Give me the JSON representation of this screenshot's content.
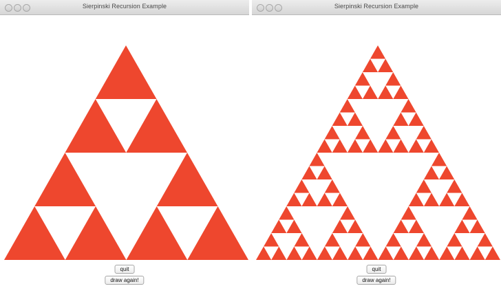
{
  "colors": {
    "fill": "#ee472e",
    "hole": "#ffffff"
  },
  "windows": [
    {
      "title": "Sierpinski Recursion Example",
      "depth": 2,
      "buttons": {
        "quit": "quit",
        "draw_again": "draw again!"
      }
    },
    {
      "title": "Sierpinski Recursion Example",
      "depth": 4,
      "buttons": {
        "quit": "quit",
        "draw_again": "draw again!"
      }
    }
  ]
}
